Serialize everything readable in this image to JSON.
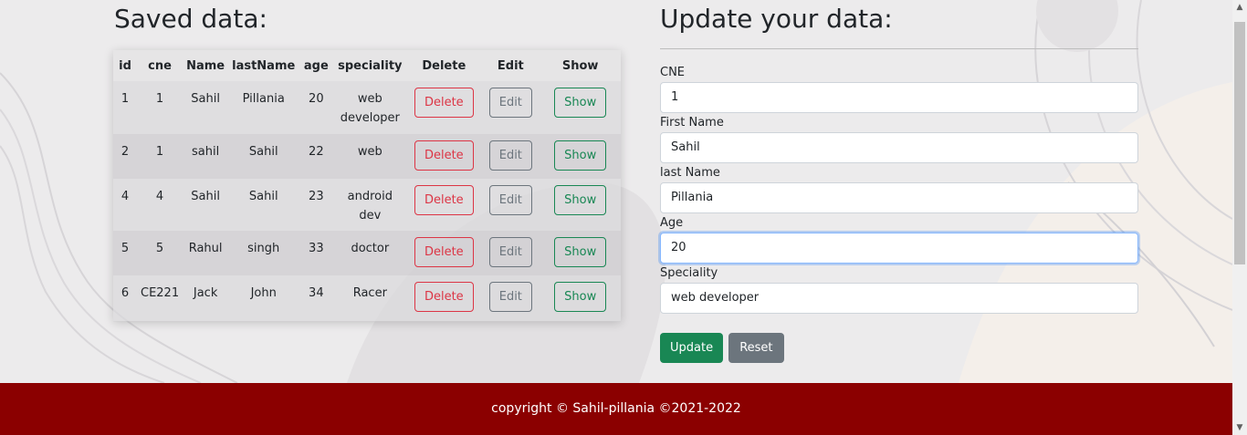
{
  "left": {
    "heading": "Saved data:",
    "columns": [
      "id",
      "cne",
      "Name",
      "lastName",
      "age",
      "speciality",
      "Delete",
      "Edit",
      "Show"
    ],
    "rows": [
      {
        "id": "1",
        "cne": "1",
        "name": "Sahil",
        "lastName": "Pillania",
        "age": "20",
        "speciality": "web developer"
      },
      {
        "id": "2",
        "cne": "1",
        "name": "sahil",
        "lastName": "Sahil",
        "age": "22",
        "speciality": "web"
      },
      {
        "id": "4",
        "cne": "4",
        "name": "Sahil",
        "lastName": "Sahil",
        "age": "23",
        "speciality": "android dev"
      },
      {
        "id": "5",
        "cne": "5",
        "name": "Rahul",
        "lastName": "singh",
        "age": "33",
        "speciality": "doctor"
      },
      {
        "id": "6",
        "cne": "CE221",
        "name": "Jack",
        "lastName": "John",
        "age": "34",
        "speciality": "Racer"
      }
    ],
    "delete_label": "Delete",
    "edit_label": "Edit",
    "show_label": "Show"
  },
  "right": {
    "heading": "Update your data:",
    "fields": [
      {
        "label": "CNE",
        "value": "1"
      },
      {
        "label": "First Name",
        "value": "Sahil"
      },
      {
        "label": "last Name",
        "value": "Pillania"
      },
      {
        "label": "Age",
        "value": "20"
      },
      {
        "label": "Speciality",
        "value": "web developer"
      }
    ],
    "update_label": "Update",
    "reset_label": "Reset"
  },
  "footer": {
    "text": "copyright © Sahil-pillania ©2021-2022"
  },
  "colors": {
    "danger": "#dc3545",
    "secondary": "#6c757d",
    "success": "#198754",
    "footer": "#8b0000"
  },
  "icons": {
    "scroll_up": "scroll-up-arrow-icon",
    "scroll_down": "scroll-down-arrow-icon"
  }
}
